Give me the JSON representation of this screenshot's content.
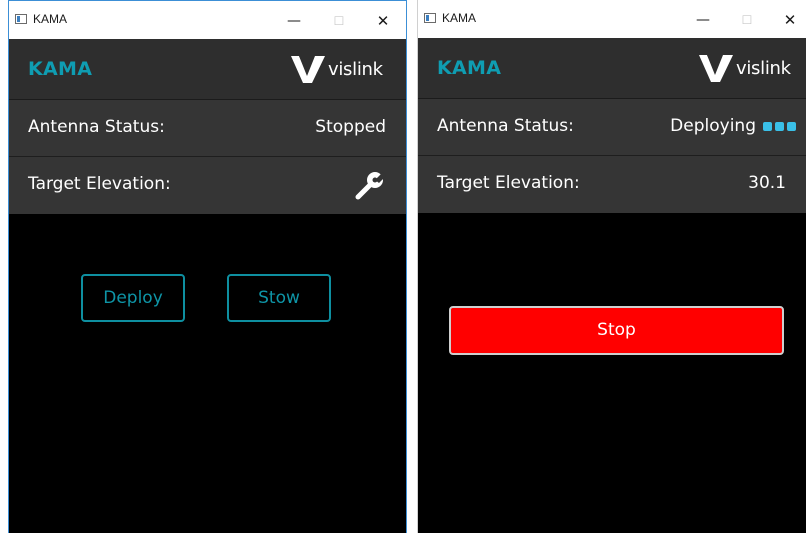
{
  "colors": {
    "brand": "#0f9db2",
    "header_bg": "#2e2e2e",
    "row_bg": "#353535",
    "content_bg": "#000000",
    "button_outline": "#0e8fa0",
    "stop_button": "#ff0000",
    "deploying_dots": "#3ac0e8"
  },
  "windows": [
    {
      "title": "KAMA",
      "caption_buttons": {
        "minimize": "—",
        "maximize": "☐",
        "close": "✕"
      },
      "header": {
        "app_name": "KAMA",
        "logo_text": "vislink",
        "logo_icon": "vislink-logo-icon"
      },
      "antenna_status": {
        "label": "Antenna Status:",
        "value": "Stopped"
      },
      "target_elevation": {
        "label": "Target Elevation:",
        "icon": "wrench-icon"
      },
      "buttons": {
        "deploy": "Deploy",
        "stow": "Stow"
      }
    },
    {
      "title": "KAMA",
      "caption_buttons": {
        "minimize": "—",
        "maximize": "☐",
        "close": "✕"
      },
      "header": {
        "app_name": "KAMA",
        "logo_text": "vislink",
        "logo_icon": "vislink-logo-icon"
      },
      "antenna_status": {
        "label": "Antenna Status:",
        "value": "Deploying",
        "progress_icon": "progress-dots-icon"
      },
      "target_elevation": {
        "label": "Target Elevation:",
        "value": "30.1"
      },
      "buttons": {
        "stop": "Stop"
      }
    }
  ]
}
